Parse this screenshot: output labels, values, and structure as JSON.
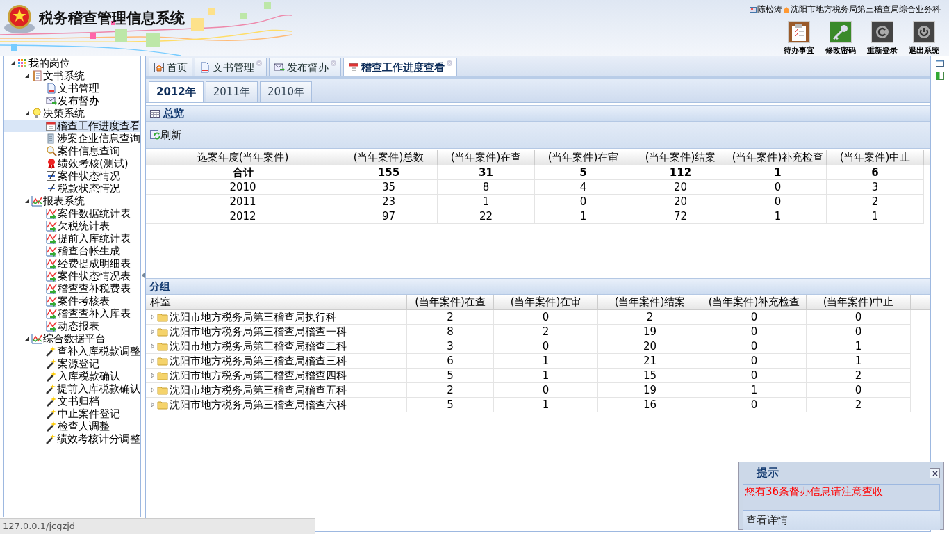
{
  "header": {
    "title": "税务稽查管理信息系统",
    "user": "陈松涛",
    "department": "沈阳市地方税务局第三稽查局综合业务科",
    "actions": [
      {
        "label": "待办事宜",
        "kind": "clipboard"
      },
      {
        "label": "修改密码",
        "kind": "key"
      },
      {
        "label": "重新登录",
        "kind": "relogin"
      },
      {
        "label": "退出系统",
        "kind": "power"
      }
    ]
  },
  "sidebar": {
    "tree": [
      {
        "label": "我的岗位",
        "kind": "grid",
        "expanded": true,
        "selected": false,
        "children": [
          {
            "label": "文书系统",
            "kind": "notebook",
            "expanded": true,
            "selected": false,
            "children": [
              {
                "label": "文书管理",
                "kind": "doc",
                "selected": false
              },
              {
                "label": "发布督办",
                "kind": "mail",
                "selected": false
              }
            ]
          },
          {
            "label": "决策系统",
            "kind": "bulb",
            "expanded": true,
            "selected": false,
            "children": [
              {
                "label": "稽查工作进度查看",
                "kind": "calendar",
                "selected": true
              },
              {
                "label": "涉案企业信息查询",
                "kind": "building",
                "selected": false
              },
              {
                "label": "案件信息查询",
                "kind": "magnifier",
                "selected": false
              },
              {
                "label": "绩效考核(测试)",
                "kind": "ribbon",
                "selected": false
              },
              {
                "label": "案件状态情况",
                "kind": "edit",
                "selected": false
              },
              {
                "label": "税款状态情况",
                "kind": "edit",
                "selected": false
              }
            ]
          },
          {
            "label": "报表系统",
            "kind": "chart",
            "expanded": true,
            "selected": false,
            "children": [
              {
                "label": "案件数据统计表",
                "kind": "chartgo",
                "selected": false
              },
              {
                "label": "欠税统计表",
                "kind": "chartgo",
                "selected": false
              },
              {
                "label": "提前入库统计表",
                "kind": "chartgo",
                "selected": false
              },
              {
                "label": "稽查台帐生成",
                "kind": "chartgo",
                "selected": false
              },
              {
                "label": "经费提成明细表",
                "kind": "chartgo",
                "selected": false
              },
              {
                "label": "案件状态情况表",
                "kind": "chartgo",
                "selected": false
              },
              {
                "label": "稽查查补税费表",
                "kind": "chartgo",
                "selected": false
              },
              {
                "label": "案件考核表",
                "kind": "chartgo",
                "selected": false
              },
              {
                "label": "稽查查补入库表",
                "kind": "chartgo",
                "selected": false
              },
              {
                "label": "动态报表",
                "kind": "chartgo",
                "selected": false
              }
            ]
          },
          {
            "label": "综合数据平台",
            "kind": "chart",
            "expanded": true,
            "selected": false,
            "children": [
              {
                "label": "查补入库税款调整",
                "kind": "wand",
                "selected": false
              },
              {
                "label": "案源登记",
                "kind": "wand",
                "selected": false
              },
              {
                "label": "入库税款确认",
                "kind": "wand",
                "selected": false
              },
              {
                "label": "提前入库税款确认",
                "kind": "wand",
                "selected": false
              },
              {
                "label": "文书归档",
                "kind": "wand",
                "selected": false
              },
              {
                "label": "中止案件登记",
                "kind": "wand",
                "selected": false
              },
              {
                "label": "检查人调整",
                "kind": "wand",
                "selected": false
              },
              {
                "label": "绩效考核计分调整",
                "kind": "wand",
                "selected": false
              }
            ]
          }
        ]
      }
    ]
  },
  "tabs": [
    {
      "label": "首页",
      "kind": "home",
      "closable": false,
      "selected": false
    },
    {
      "label": "文书管理",
      "kind": "doc",
      "closable": true,
      "selected": false
    },
    {
      "label": "发布督办",
      "kind": "mail",
      "closable": true,
      "selected": false
    },
    {
      "label": "稽查工作进度查看",
      "kind": "calendar",
      "closable": true,
      "selected": true
    }
  ],
  "year_tabs": [
    {
      "label": "2012年",
      "selected": true
    },
    {
      "label": "2011年",
      "selected": false
    },
    {
      "label": "2010年",
      "selected": false
    }
  ],
  "overview": {
    "title": "总览",
    "toolbar": [
      {
        "label": "刷新"
      }
    ],
    "table": {
      "columns": [
        "选案年度(当年案件)",
        "(当年案件)总数",
        "(当年案件)在查",
        "(当年案件)在审",
        "(当年案件)结案",
        "(当年案件)补充检查",
        "(当年案件)中止"
      ],
      "rows": [
        {
          "kind": "total",
          "cells": [
            "合计",
            "155",
            "31",
            "5",
            "112",
            "1",
            "6"
          ]
        },
        {
          "kind": "data",
          "cells": [
            "2010",
            "35",
            "8",
            "4",
            "20",
            "0",
            "3"
          ]
        },
        {
          "kind": "data",
          "cells": [
            "2011",
            "23",
            "1",
            "0",
            "20",
            "0",
            "2"
          ]
        },
        {
          "kind": "data",
          "cells": [
            "2012",
            "97",
            "22",
            "1",
            "72",
            "1",
            "1"
          ]
        }
      ]
    }
  },
  "groups": {
    "title": "分组",
    "table": {
      "columns": [
        "科室",
        "(当年案件)在查",
        "(当年案件)在审",
        "(当年案件)结案",
        "(当年案件)补充检查",
        "(当年案件)中止"
      ],
      "rows": [
        {
          "expanded": false,
          "cells": [
            "沈阳市地方税务局第三稽查局执行科",
            "2",
            "0",
            "2",
            "0",
            "0"
          ]
        },
        {
          "expanded": false,
          "cells": [
            "沈阳市地方税务局第三稽查局稽查一科",
            "8",
            "2",
            "19",
            "0",
            "0"
          ]
        },
        {
          "expanded": false,
          "cells": [
            "沈阳市地方税务局第三稽查局稽查二科",
            "3",
            "0",
            "20",
            "0",
            "1"
          ]
        },
        {
          "expanded": false,
          "cells": [
            "沈阳市地方税务局第三稽查局稽查三科",
            "6",
            "1",
            "21",
            "0",
            "1"
          ]
        },
        {
          "expanded": false,
          "cells": [
            "沈阳市地方税务局第三稽查局稽查四科",
            "5",
            "1",
            "15",
            "0",
            "2"
          ]
        },
        {
          "expanded": false,
          "cells": [
            "沈阳市地方税务局第三稽查局稽查五科",
            "2",
            "0",
            "19",
            "1",
            "0"
          ]
        },
        {
          "expanded": false,
          "cells": [
            "沈阳市地方税务局第三稽查局稽查六科",
            "5",
            "1",
            "16",
            "0",
            "2"
          ]
        }
      ]
    }
  },
  "status_bar": "127.0.0.1/jcgzjd",
  "notification": {
    "title": "提示",
    "message": "您有36条督办信息请注意查收",
    "link": "查看详情"
  }
}
